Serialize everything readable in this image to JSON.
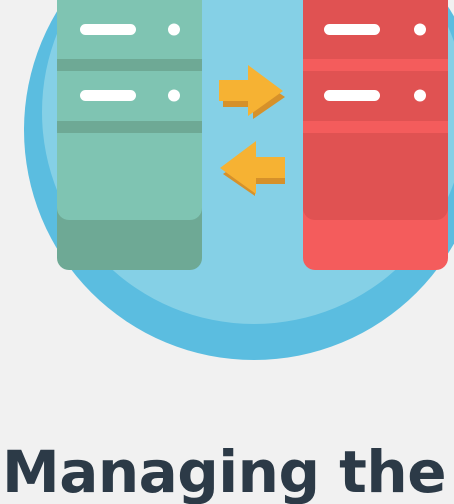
{
  "headline": "Managing the fa",
  "icons": [
    "server-sync-illustration",
    "arrow-right-icon",
    "arrow-left-icon",
    "server-icon"
  ],
  "colors": {
    "background": "#f1f1f1",
    "circle_outer": "#5bbde0",
    "circle_inner": "#85d0e6",
    "server_left": "#7fc4b2",
    "server_left_dark": "#6ea995",
    "server_right": "#e05252",
    "server_right_dark": "#f45c5c",
    "arrow": "#f6b233",
    "arrow_shadow": "#d6912a",
    "text": "#2c3a47"
  }
}
